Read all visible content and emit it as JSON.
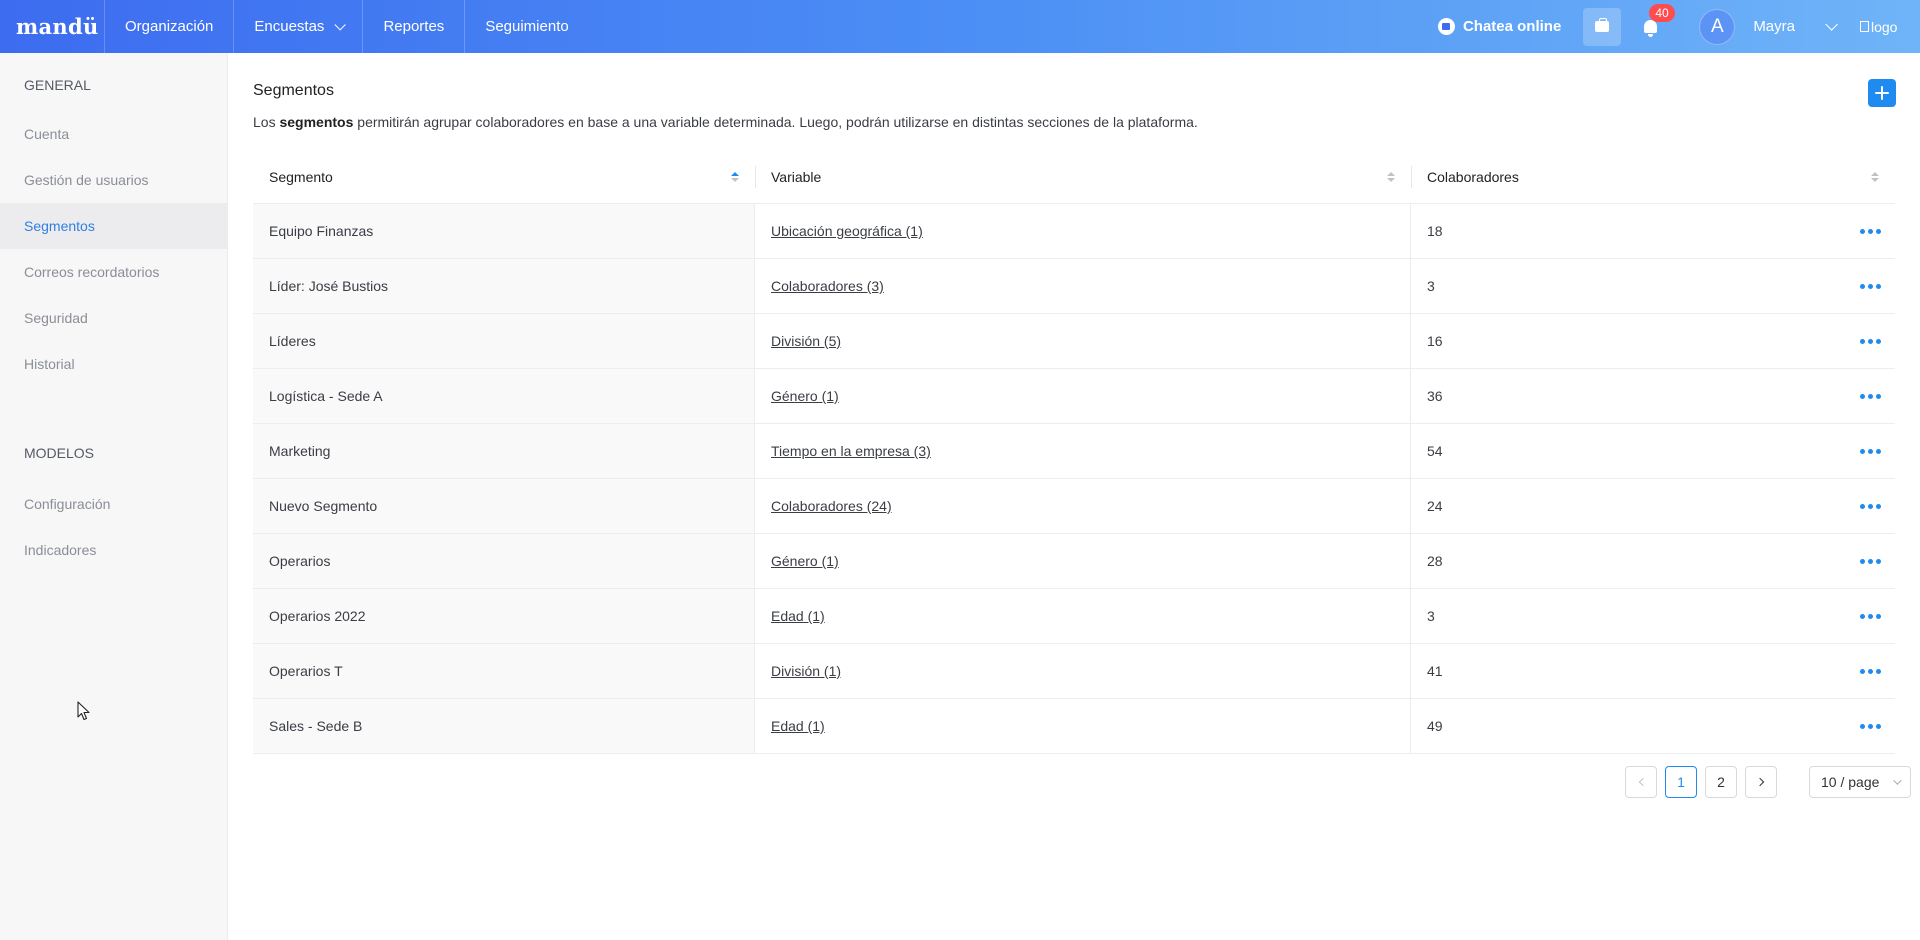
{
  "header": {
    "brand": "mandü",
    "nav": [
      {
        "label": "Organización"
      },
      {
        "label": "Encuestas"
      },
      {
        "label": "Reportes"
      },
      {
        "label": "Seguimiento"
      }
    ],
    "chat_label": "Chatea online",
    "notifications_count": "40",
    "avatar_letter": "A",
    "user_name": "Mayra",
    "logo_alt": "logo"
  },
  "sidebar": {
    "general_title": "GENERAL",
    "general_items": [
      {
        "label": "Cuenta"
      },
      {
        "label": "Gestión de usuarios"
      },
      {
        "label": "Segmentos"
      },
      {
        "label": "Correos recordatorios"
      },
      {
        "label": "Seguridad"
      },
      {
        "label": "Historial"
      }
    ],
    "models_title": "MODELOS",
    "models_items": [
      {
        "label": "Configuración"
      },
      {
        "label": "Indicadores"
      }
    ],
    "active": "Segmentos"
  },
  "main": {
    "title": "Segmentos",
    "description": {
      "before": "Los ",
      "bold": "segmentos",
      "after": " permitirán agrupar colaboradores en base a una variable determinada. Luego, podrán utilizarse en distintas secciones de la plataforma."
    },
    "columns": [
      "Segmento",
      "Variable",
      "Colaboradores"
    ],
    "rows": [
      {
        "segment": "Equipo Finanzas",
        "variable": "Ubicación geográfica (1)",
        "count": "18"
      },
      {
        "segment": "Líder: José Bustios",
        "variable": "Colaboradores (3)",
        "count": "3"
      },
      {
        "segment": "Líderes",
        "variable": "División (5)",
        "count": "16"
      },
      {
        "segment": "Logística - Sede A",
        "variable": "Género (1)",
        "count": "36"
      },
      {
        "segment": "Marketing",
        "variable": "Tiempo en la empresa (3)",
        "count": "54"
      },
      {
        "segment": "Nuevo Segmento",
        "variable": "Colaboradores (24)",
        "count": "24"
      },
      {
        "segment": "Operarios",
        "variable": "Género (1)",
        "count": "28"
      },
      {
        "segment": "Operarios 2022",
        "variable": "Edad (1)",
        "count": "3"
      },
      {
        "segment": "Operarios T",
        "variable": "División (1)",
        "count": "41"
      },
      {
        "segment": "Sales - Sede B",
        "variable": "Edad (1)",
        "count": "49"
      }
    ],
    "pagination": {
      "pages": [
        "1",
        "2"
      ],
      "current": "1",
      "page_size": "10 / page"
    }
  },
  "colors": {
    "accent": "#1f8bf0",
    "header_start": "#3d6cf0",
    "header_end": "#6fb4f8",
    "badge": "#ff4d4f"
  }
}
